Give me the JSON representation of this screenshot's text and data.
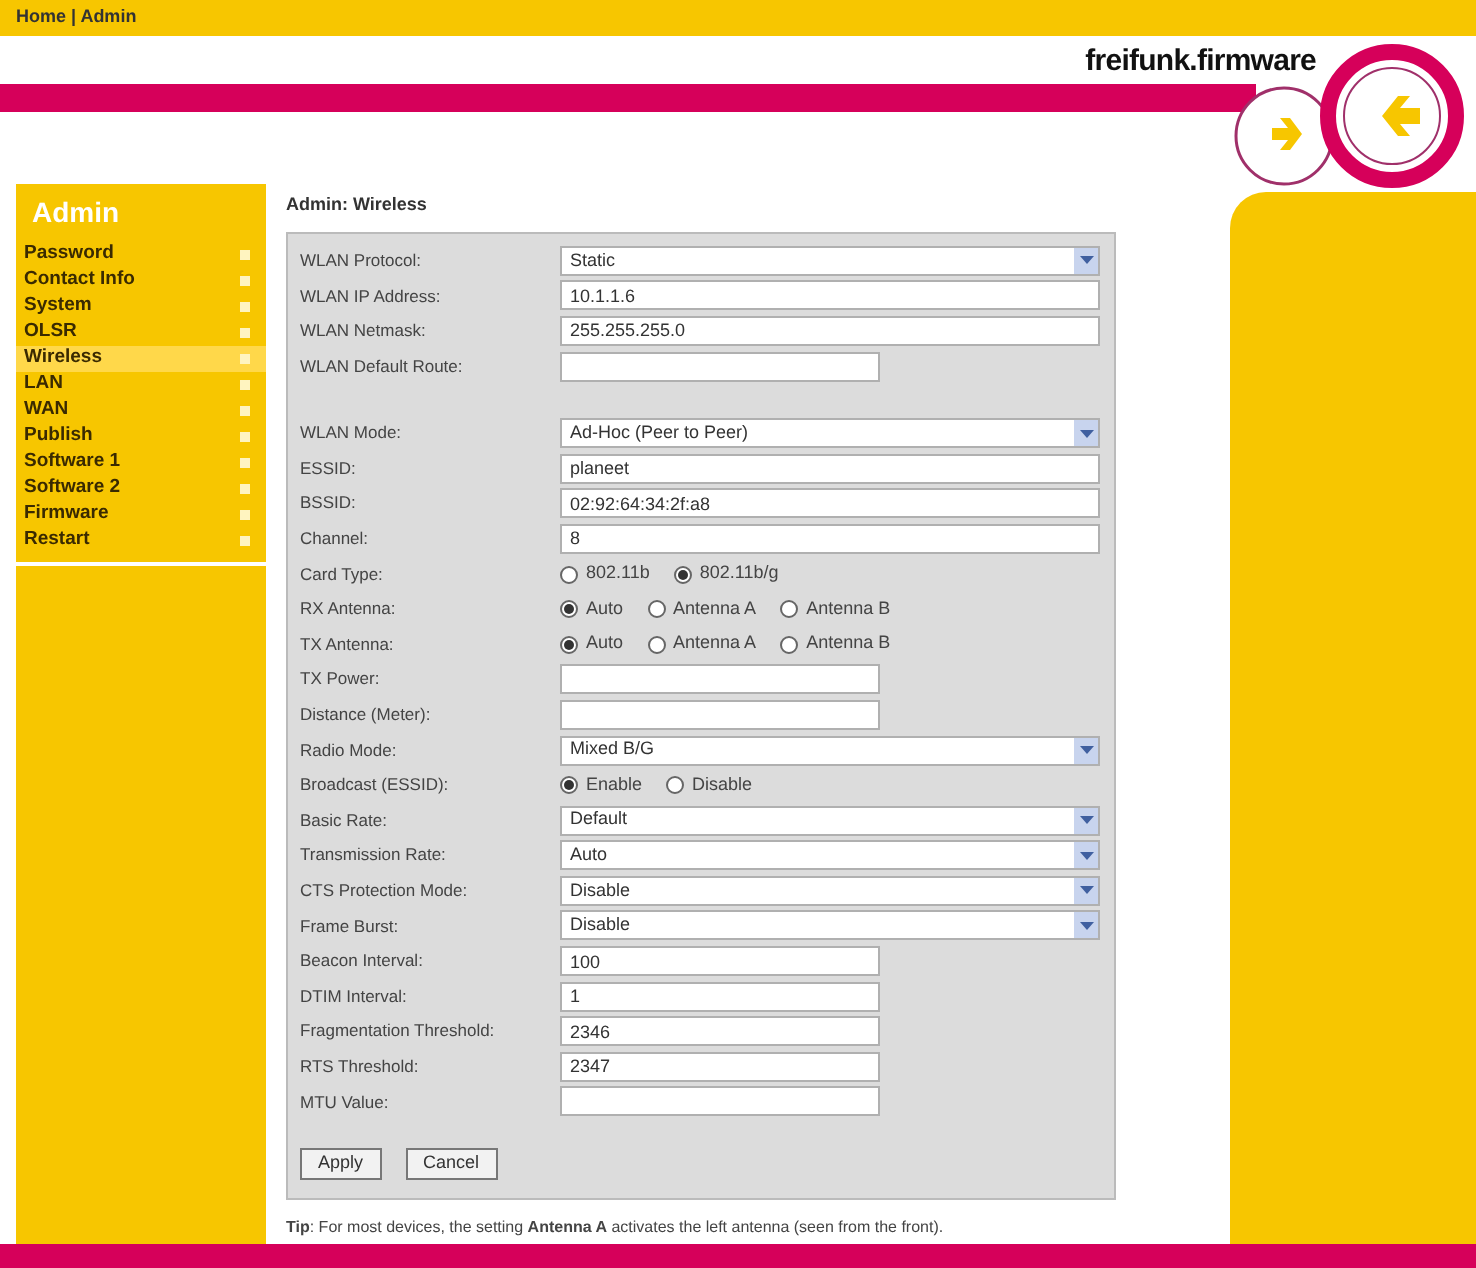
{
  "breadcrumb": "Home | Admin",
  "brand": "freifunk.firmware",
  "sidebar": {
    "title": "Admin",
    "items": [
      {
        "label": "Password",
        "selected": false
      },
      {
        "label": "Contact Info",
        "selected": false
      },
      {
        "label": "System",
        "selected": false
      },
      {
        "label": "OLSR",
        "selected": false
      },
      {
        "label": "Wireless",
        "selected": true
      },
      {
        "label": "LAN",
        "selected": false
      },
      {
        "label": "WAN",
        "selected": false
      },
      {
        "label": "Publish",
        "selected": false
      },
      {
        "label": "Software 1",
        "selected": false
      },
      {
        "label": "Software 2",
        "selected": false
      },
      {
        "label": "Firmware",
        "selected": false
      },
      {
        "label": "Restart",
        "selected": false
      }
    ]
  },
  "page_title": "Admin: Wireless",
  "sections": [
    [
      {
        "kind": "select",
        "label": "WLAN Protocol:",
        "value": "Static"
      },
      {
        "kind": "text",
        "label": "WLAN IP Address:",
        "value": "10.1.1.6",
        "wide": true
      },
      {
        "kind": "text",
        "label": "WLAN Netmask:",
        "value": "255.255.255.0",
        "wide": true
      },
      {
        "kind": "text",
        "label": "WLAN Default Route:",
        "wide": false
      }
    ],
    [
      {
        "kind": "select",
        "label": "WLAN Mode:",
        "value": "Ad-Hoc (Peer to Peer)"
      },
      {
        "kind": "text",
        "label": "ESSID:",
        "value": "planeet",
        "wide": true
      },
      {
        "kind": "text",
        "label": "BSSID:",
        "value": "02:92:64:34:2f:a8",
        "wide": true
      },
      {
        "kind": "text",
        "label": "Channel:",
        "value": "8",
        "wide": true
      },
      {
        "kind": "radio",
        "label": "Card Type:",
        "options": [
          {
            "label": "802.11b",
            "selected": false
          },
          {
            "label": "802.11b/g",
            "selected": true
          }
        ]
      },
      {
        "kind": "radio",
        "label": "RX Antenna:",
        "options": [
          {
            "label": "Auto",
            "selected": true
          },
          {
            "label": "Antenna A",
            "selected": false
          },
          {
            "label": "Antenna B",
            "selected": false
          }
        ]
      },
      {
        "kind": "radio",
        "label": "TX Antenna:",
        "options": [
          {
            "label": "Auto",
            "selected": true
          },
          {
            "label": "Antenna A",
            "selected": false
          },
          {
            "label": "Antenna B",
            "selected": false
          }
        ]
      },
      {
        "kind": "text",
        "label": "TX Power:",
        "wide": false
      },
      {
        "kind": "text",
        "label": "Distance (Meter):",
        "wide": false
      },
      {
        "kind": "select",
        "label": "Radio Mode:",
        "value": "Mixed B/G"
      },
      {
        "kind": "radio",
        "label": "Broadcast (ESSID):",
        "options": [
          {
            "label": "Enable",
            "selected": true
          },
          {
            "label": "Disable",
            "selected": false
          }
        ]
      },
      {
        "kind": "select",
        "label": "Basic Rate:",
        "value": "Default"
      },
      {
        "kind": "select",
        "label": "Transmission Rate:",
        "value": "Auto"
      },
      {
        "kind": "select",
        "label": "CTS Protection Mode:",
        "value": "Disable"
      },
      {
        "kind": "select",
        "label": "Frame Burst:",
        "value": "Disable"
      },
      {
        "kind": "text",
        "label": "Beacon Interval:",
        "value": "100",
        "wide": false
      },
      {
        "kind": "text",
        "label": "DTIM Interval:",
        "value": "1",
        "wide": false
      },
      {
        "kind": "text",
        "label": "Fragmentation Threshold:",
        "value": "2346",
        "wide": false
      },
      {
        "kind": "text",
        "label": "RTS Threshold:",
        "value": "2347",
        "wide": false
      },
      {
        "kind": "text",
        "label": "MTU Value:",
        "wide": false
      }
    ]
  ],
  "buttons": [
    "Apply",
    "Cancel"
  ],
  "tip": "**Tip**: For most devices, the setting **Antenna A** activates the left antenna (seen from the front)."
}
